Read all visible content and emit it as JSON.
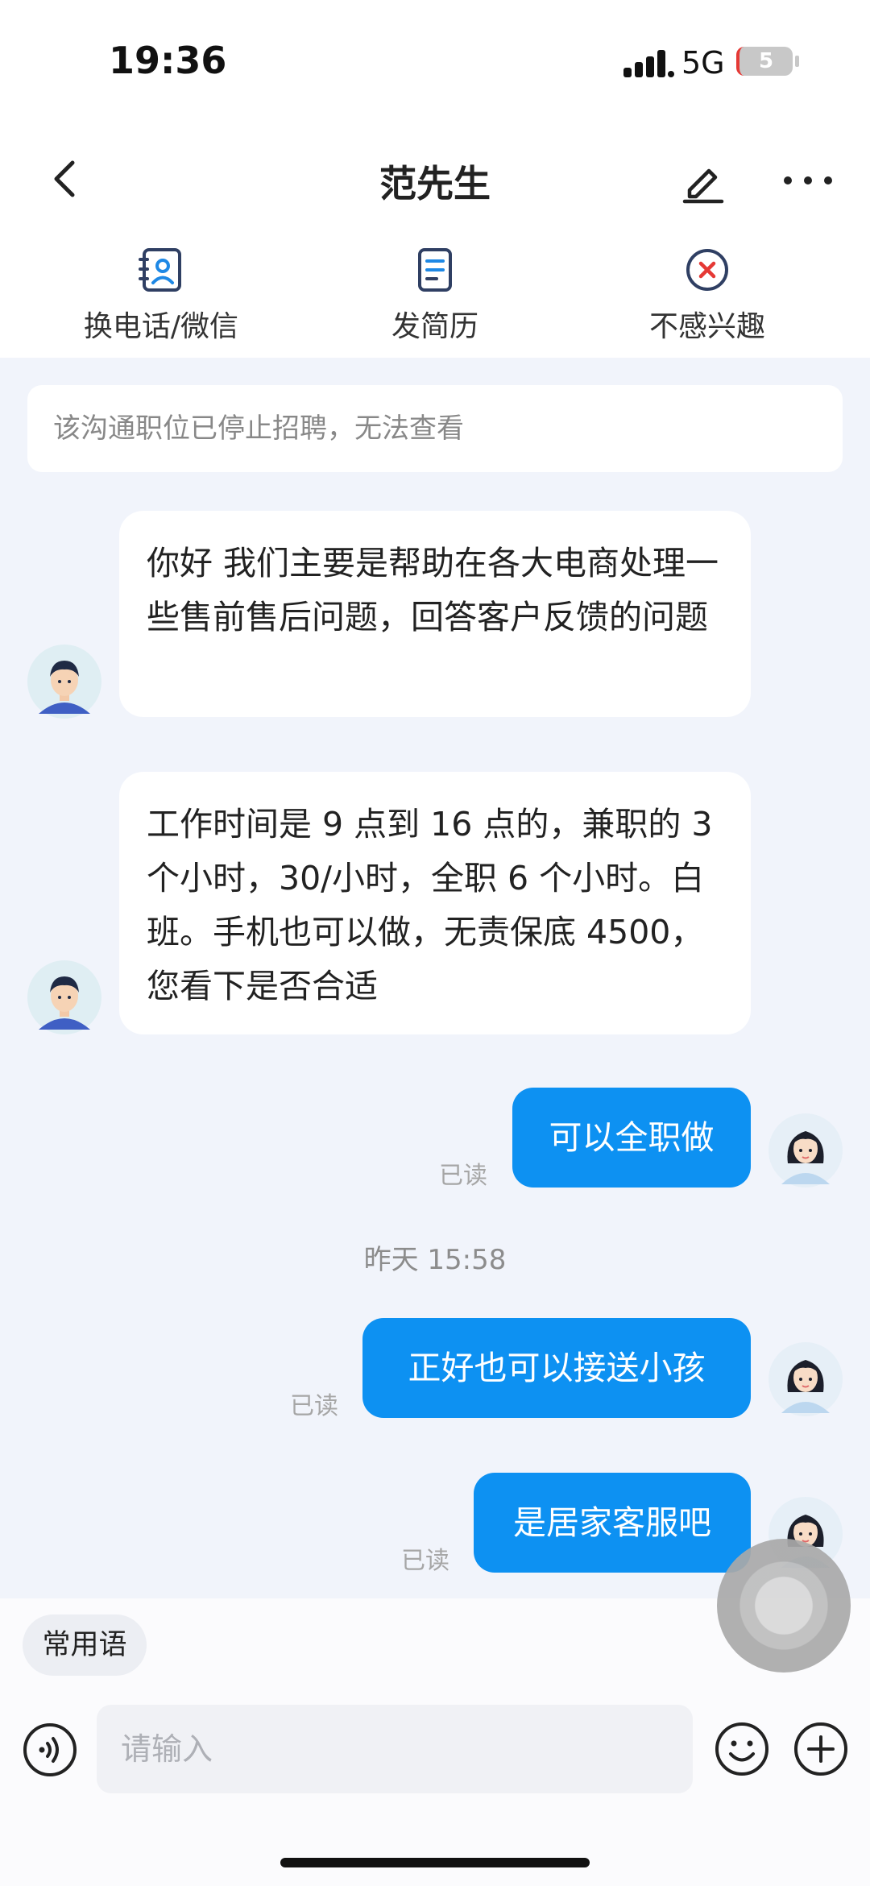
{
  "status_bar": {
    "time": "19:36",
    "network": "5G",
    "battery": "5"
  },
  "header": {
    "title": "范先生"
  },
  "actions": [
    {
      "label": "换电话/微信",
      "icon": "contact-card-icon"
    },
    {
      "label": "发简历",
      "icon": "resume-icon"
    },
    {
      "label": "不感兴趣",
      "icon": "not-interested-icon"
    }
  ],
  "notice": "该沟通职位已停止招聘，无法查看",
  "messages": [
    {
      "direction": "in",
      "text": "你好 我们主要是帮助在各大电商处理一些售前售后问题，回答客户反馈的问题"
    },
    {
      "direction": "in",
      "text": "工作时间是 9 点到 16 点的，兼职的 3 个小时，30/小时，全职 6 个小时。白班。手机也可以做，无责保底 4500，您看下是否合适"
    },
    {
      "direction": "out",
      "text": "可以全职做",
      "status": "已读"
    },
    {
      "direction": "out",
      "text": "正好也可以接送小孩",
      "status": "已读"
    },
    {
      "direction": "out",
      "text": "是居家客服吧",
      "status": "已读"
    }
  ],
  "timestamp": "昨天 15:58",
  "quick_phrases": "常用语",
  "input": {
    "placeholder": "请输入"
  },
  "colors": {
    "accent": "#0d91f2",
    "chat_bg": "#f1f4fb",
    "danger": "#e53935"
  }
}
